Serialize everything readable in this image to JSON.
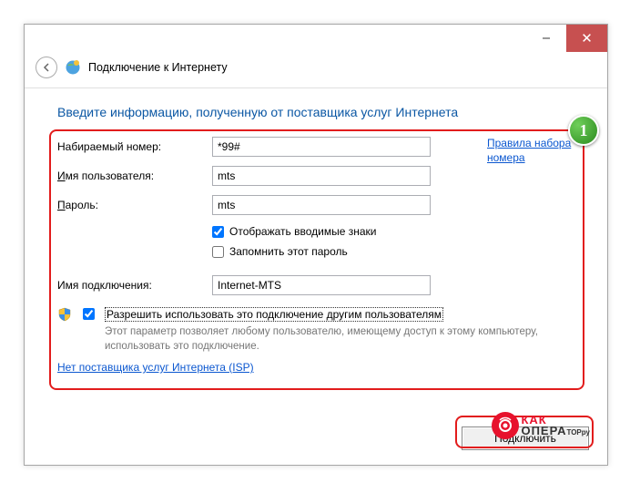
{
  "window": {
    "title": "Подключение к Интернету"
  },
  "heading": "Введите информацию, полученную от поставщика услуг Интернета",
  "labels": {
    "dial": "Набираемый номер:",
    "dial_ul_char": "Н",
    "user": "Имя пользователя:",
    "user_prefix": "И",
    "password": "Пароль:",
    "password_ul_char": "П",
    "connname": "Имя подключения:"
  },
  "values": {
    "dial": "*99#",
    "user": "mts",
    "password": "mts",
    "connname": "Internet-MTS"
  },
  "checks": {
    "show_chars": "Отображать вводимые знаки",
    "remember": "Запомнить этот пароль",
    "allow_all_title": "Разрешить использовать это подключение другим пользователям",
    "allow_all_desc": "Этот параметр позволяет любому пользователю, имеющему доступ к этому компьютеру, использовать это подключение."
  },
  "links": {
    "dial_rules_l1": "Правила набора",
    "dial_rules_l2": "номера",
    "no_isp": "Нет поставщика услуг Интернета (ISP)"
  },
  "buttons": {
    "connect": "Подключить"
  },
  "annotations": {
    "badge": "1"
  },
  "watermark": {
    "line1": "КАК",
    "line2": "ОПЕРА",
    "suffix": "ТОР",
    "tld": "ру"
  }
}
